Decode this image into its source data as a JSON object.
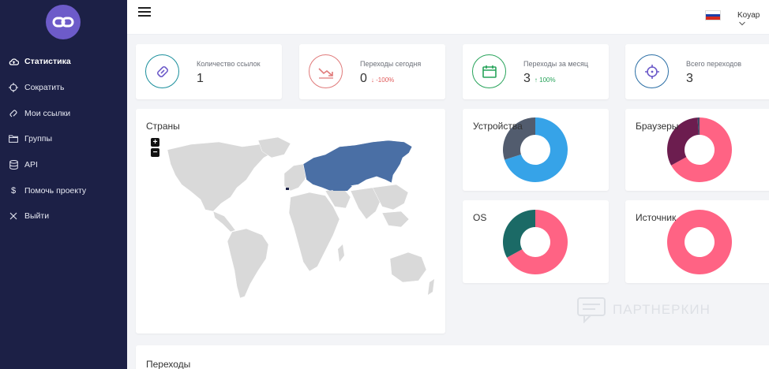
{
  "sidebar": {
    "logo_icon": "link-logo-icon",
    "items": [
      {
        "label": "Статистика",
        "icon": "cloud-icon",
        "active": true
      },
      {
        "label": "Сократить",
        "icon": "crosshair-icon"
      },
      {
        "label": "Мои ссылки",
        "icon": "link-icon"
      },
      {
        "label": "Группы",
        "icon": "folder-icon"
      },
      {
        "label": "API",
        "icon": "database-icon"
      },
      {
        "label": "Помочь проекту",
        "icon": "dollar-icon"
      },
      {
        "label": "Выйти",
        "icon": "close-icon"
      }
    ]
  },
  "header": {
    "menu_icon": "hamburger-icon",
    "flag_icon": "russia-flag-icon",
    "user": "Koyap"
  },
  "stats": [
    {
      "label": "Количество ссылок",
      "value": "1",
      "change": "",
      "color": "#1a8f9c"
    },
    {
      "label": "Переходы сегодня",
      "value": "0",
      "change": "-100%",
      "direction": "down",
      "color": "#e07a7a"
    },
    {
      "label": "Переходы за месяц",
      "value": "3",
      "change": "100%",
      "direction": "up",
      "color": "#27a35a"
    },
    {
      "label": "Всего переходов",
      "value": "3",
      "change": "",
      "color": "#2a6ea5"
    }
  ],
  "map_card": {
    "title": "Страны",
    "zoom_in": "+",
    "zoom_out": "−"
  },
  "donuts": [
    {
      "title": "Устройства",
      "segments": [
        {
          "value": 70,
          "color": "#36a3e8"
        },
        {
          "value": 30,
          "color": "#525c6e"
        }
      ]
    },
    {
      "title": "Браузеры",
      "segments": [
        {
          "value": 67,
          "color": "#ff6384"
        },
        {
          "value": 32,
          "color": "#6c1d4f"
        },
        {
          "value": 1,
          "color": "#3d4a66"
        }
      ]
    },
    {
      "title": "OS",
      "segments": [
        {
          "value": 67,
          "color": "#ff6384"
        },
        {
          "value": 33,
          "color": "#1b6a66"
        }
      ]
    },
    {
      "title": "Источник",
      "segments": [
        {
          "value": 100,
          "color": "#ff6384"
        }
      ]
    }
  ],
  "transitions_card": {
    "title": "Переходы"
  },
  "watermark": {
    "text": "ПАРТНЕРКИН"
  },
  "colors": {
    "sidebar_bg": "#1c2046",
    "accent": "#6d5bc9",
    "map_highlight": "#4a6fa5",
    "map_land": "#d9d9d9"
  }
}
